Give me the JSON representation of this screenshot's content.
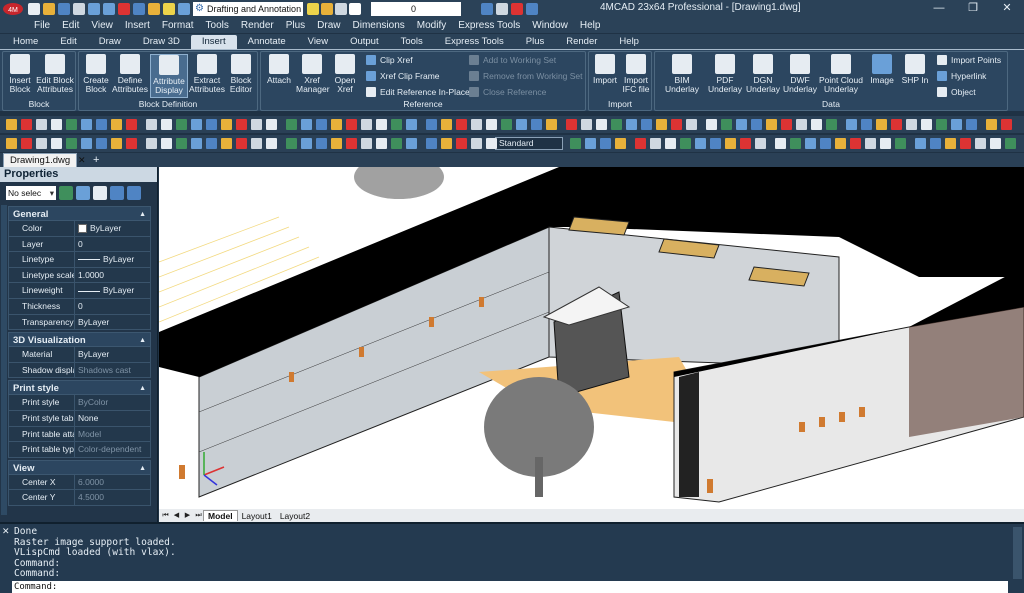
{
  "title_bar": {
    "workspace": "Drafting and Annotation",
    "layer_value": "0",
    "window_title": "4MCAD 23x64 Professional - [Drawing1.dwg]",
    "minimize": "—",
    "restore": "❐",
    "close": "✕"
  },
  "menu": [
    "File",
    "Edit",
    "View",
    "Insert",
    "Format",
    "Tools",
    "Render",
    "Plus",
    "Draw",
    "Dimensions",
    "Modify",
    "Express Tools",
    "Window",
    "Help"
  ],
  "ribbon_tabs": [
    "Home",
    "Edit",
    "Draw",
    "Draw 3D",
    "Insert",
    "Annotate",
    "View",
    "Output",
    "Tools",
    "Express Tools",
    "Plus",
    "Render",
    "Help"
  ],
  "active_tab": "Insert",
  "ribbon": {
    "block_panel": {
      "title": "Block",
      "insert_block": "Insert Block",
      "edit_block_attributes": "Edit Block Attributes"
    },
    "block_definition_panel": {
      "title": "Block Definition",
      "create_block": "Create Block",
      "define_attributes": "Define Attributes",
      "attribute_display": "Attribute Display",
      "extract_attributes": "Extract Attributes",
      "block_editor": "Block Editor"
    },
    "reference_panel": {
      "title": "Reference",
      "attach": "Attach",
      "xref_manager": "Xref Manager",
      "open_xref": "Open Xref",
      "clip_xref": "Clip Xref",
      "xref_clip_frame": "Xref Clip Frame",
      "edit_reference_in_place": "Edit Reference In-Place",
      "add_to_working_set": "Add to Working Set",
      "remove_from_working_set": "Remove from Working Set",
      "close_reference": "Close Reference"
    },
    "import_panel": {
      "title": "Import",
      "import": "Import",
      "import_ifc": "Import IFC file"
    },
    "data_panel": {
      "title": "Data",
      "bim_underlay": "BIM Underlay",
      "pdf_underlay": "PDF Underlay",
      "dgn_underlay": "DGN Underlay",
      "dwf_underlay": "DWF Underlay",
      "point_cloud_underlay": "Point Cloud Underlay",
      "image": "Image",
      "shp_in": "SHP In",
      "import_points": "Import Points",
      "hyperlink": "Hyperlink",
      "object": "Object"
    }
  },
  "text_style": "Standard",
  "document_tab": "Drawing1.dwg",
  "properties": {
    "title": "Properties",
    "selection": "No selec",
    "sections": [
      {
        "name": "General",
        "rows": [
          {
            "key": "Color",
            "value": "ByLayer"
          },
          {
            "key": "Layer",
            "value": "0"
          },
          {
            "key": "Linetype",
            "value": "ByLayer"
          },
          {
            "key": "Linetype scale",
            "value": "1.0000"
          },
          {
            "key": "Lineweight",
            "value": "ByLayer"
          },
          {
            "key": "Thickness",
            "value": "0"
          },
          {
            "key": "Transparency",
            "value": "ByLayer"
          }
        ]
      },
      {
        "name": "3D Visualization",
        "rows": [
          {
            "key": "Material",
            "value": "ByLayer"
          },
          {
            "key": "Shadow display",
            "value": "Shadows cast"
          }
        ]
      },
      {
        "name": "Print style",
        "rows": [
          {
            "key": "Print style",
            "value": "ByColor"
          },
          {
            "key": "Print style table",
            "value": "None"
          },
          {
            "key": "Print table attac...",
            "value": "Model"
          },
          {
            "key": "Print table type",
            "value": "Color-dependent"
          }
        ]
      },
      {
        "name": "View",
        "rows": [
          {
            "key": "Center X",
            "value": "6.0000"
          },
          {
            "key": "Center Y",
            "value": "4.5000"
          }
        ]
      }
    ]
  },
  "layout_tabs": [
    "Model",
    "Layout1",
    "Layout2"
  ],
  "command_history": [
    "Done",
    "Raster image support loaded.",
    "VLispCmd loaded (with vlax).",
    "Command:",
    "Command:"
  ],
  "command_prompt": "Command:"
}
